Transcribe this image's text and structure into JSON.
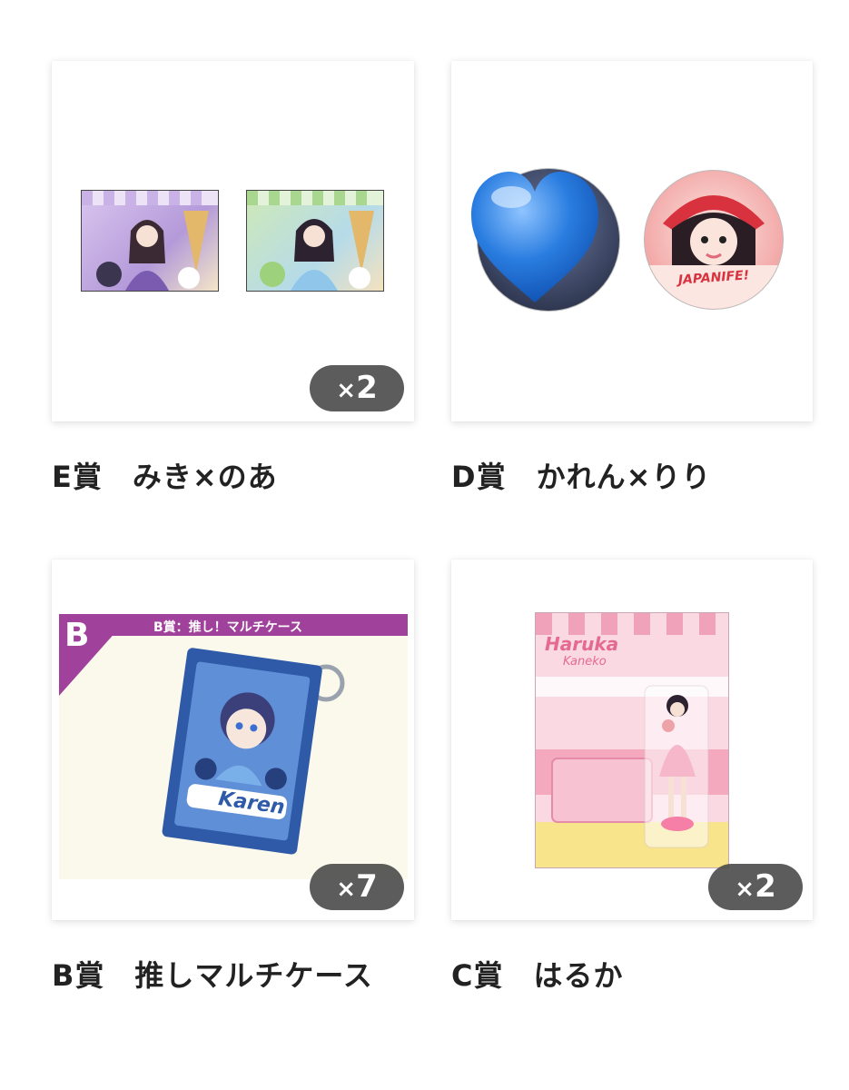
{
  "items": [
    {
      "title": "E賞　みき×のあ",
      "quantity": "2",
      "badge_prefix": "×"
    },
    {
      "title": "D賞　かれん×りり"
    },
    {
      "title": "B賞　推しマルチケース",
      "quantity": "7",
      "badge_prefix": "×",
      "banner_letter": "B",
      "banner_text": "B賞：推し！マルチケース",
      "case_name": "Karen"
    },
    {
      "title": "C賞　はるか",
      "quantity": "2",
      "badge_prefix": "×",
      "name_script_1": "Haruka",
      "name_script_2": "Kaneko"
    }
  ],
  "badge_text": "JAPANIFE!",
  "colors": {
    "banner_purple": "#a0419b",
    "heart_blue": "#2a7de0",
    "case_blue": "#2e5aa8",
    "pink": "#f7c9d7"
  }
}
